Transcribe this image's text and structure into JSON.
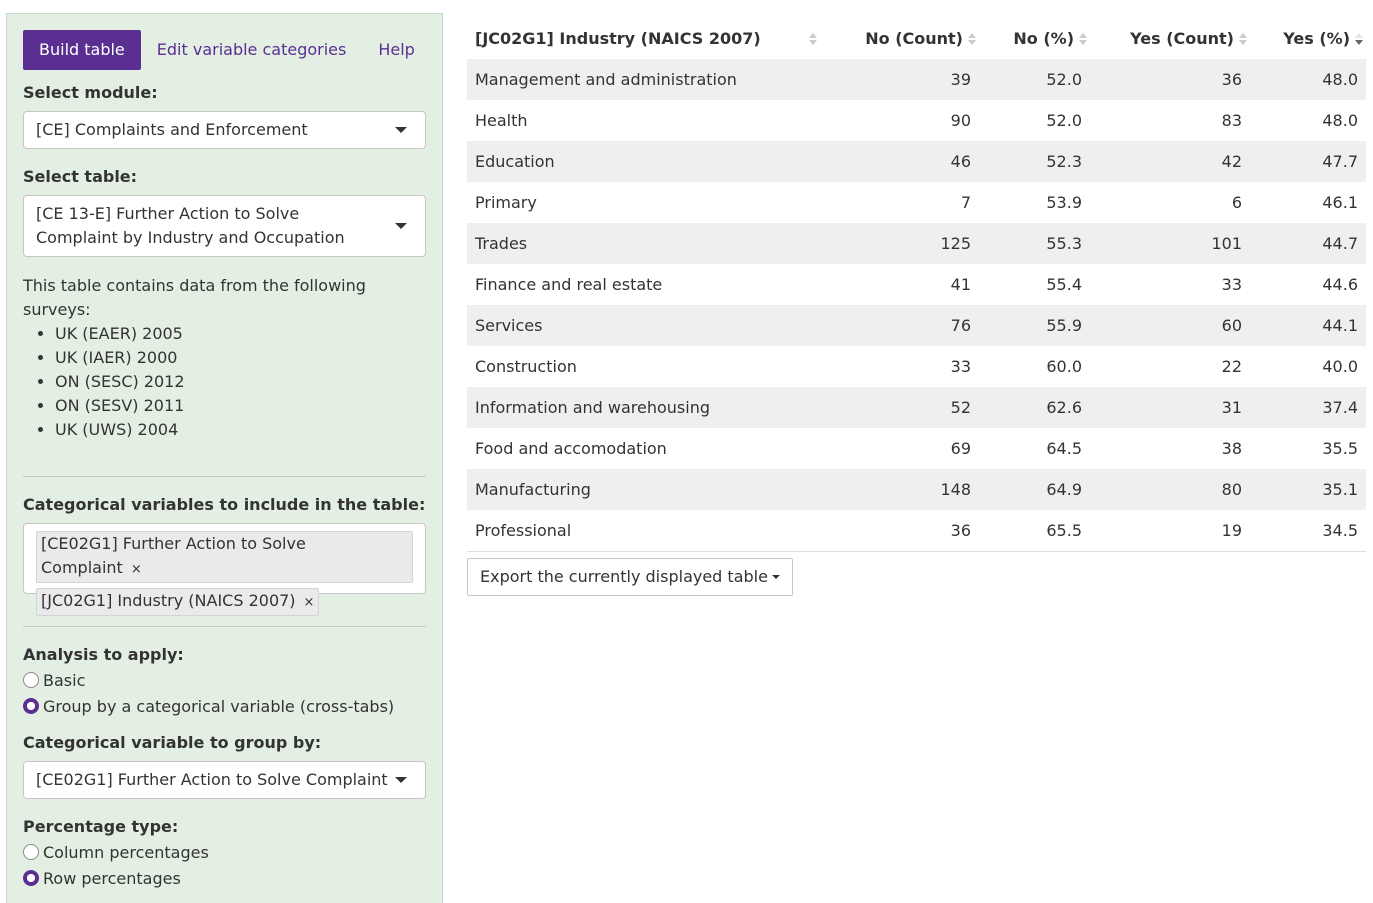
{
  "sidebar": {
    "tabs": [
      {
        "label": "Build table"
      },
      {
        "label": "Edit variable categories"
      },
      {
        "label": "Help"
      }
    ],
    "module_label": "Select module:",
    "module_value": "[CE] Complaints and Enforcement",
    "table_label": "Select table:",
    "table_value": "[CE 13-E] Further Action to Solve Complaint by Industry and Occupation",
    "surveys_intro": "This table contains data from the following surveys:",
    "surveys": [
      "UK (EAER) 2005",
      "UK (IAER) 2000",
      "ON (SESC) 2012",
      "ON (SESV) 2011",
      "UK (UWS) 2004"
    ],
    "catvars_label": "Categorical variables to include in the table:",
    "catvars": [
      "[CE02G1] Further Action to Solve Complaint",
      "[JC02G1] Industry (NAICS 2007)"
    ],
    "chip_remove": "×",
    "analysis_label": "Analysis to apply:",
    "analysis_options": [
      {
        "label": "Basic",
        "selected": false
      },
      {
        "label": "Group by a categorical variable (cross-tabs)",
        "selected": true
      }
    ],
    "groupby_label": "Categorical variable to group by:",
    "groupby_value": "[CE02G1] Further Action to Solve Complaint",
    "pct_label": "Percentage type:",
    "pct_options": [
      {
        "label": "Column percentages",
        "selected": false
      },
      {
        "label": "Row percentages",
        "selected": true
      }
    ]
  },
  "table": {
    "columns": [
      "[JC02G1] Industry (NAICS 2007)",
      "No (Count)",
      "No (%)",
      "Yes (Count)",
      "Yes (%)"
    ],
    "sorted_column": "Yes (%)",
    "sort_direction": "descending",
    "rows": [
      [
        "Management and administration",
        "39",
        "52.0",
        "36",
        "48.0"
      ],
      [
        "Health",
        "90",
        "52.0",
        "83",
        "48.0"
      ],
      [
        "Education",
        "46",
        "52.3",
        "42",
        "47.7"
      ],
      [
        "Primary",
        "7",
        "53.9",
        "6",
        "46.1"
      ],
      [
        "Trades",
        "125",
        "55.3",
        "101",
        "44.7"
      ],
      [
        "Finance and real estate",
        "41",
        "55.4",
        "33",
        "44.6"
      ],
      [
        "Services",
        "76",
        "55.9",
        "60",
        "44.1"
      ],
      [
        "Construction",
        "33",
        "60.0",
        "22",
        "40.0"
      ],
      [
        "Information and warehousing",
        "52",
        "62.6",
        "31",
        "37.4"
      ],
      [
        "Food and accomodation",
        "69",
        "64.5",
        "38",
        "35.5"
      ],
      [
        "Manufacturing",
        "148",
        "64.9",
        "80",
        "35.1"
      ],
      [
        "Professional",
        "36",
        "65.5",
        "19",
        "34.5"
      ]
    ],
    "export_label": "Export the currently displayed table"
  },
  "colors": {
    "accent": "#5b2e91",
    "sidebar_bg": "#e3efe3",
    "stripe": "#efefef"
  }
}
